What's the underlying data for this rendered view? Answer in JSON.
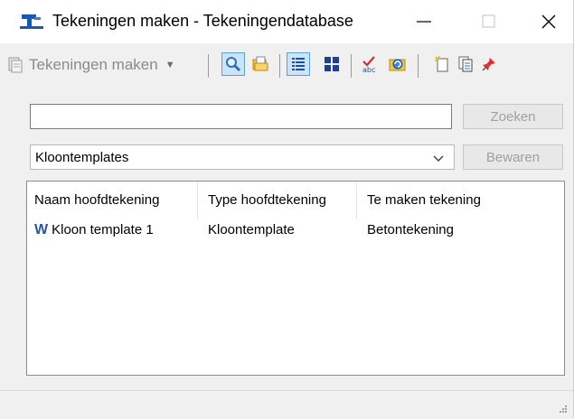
{
  "window": {
    "title": "Tekeningen maken - Tekeningendatabase",
    "minimize": "—",
    "maximize": "☐",
    "close": "✕"
  },
  "toolbar": {
    "mode_label": "Tekeningen maken",
    "buttons": [
      {
        "name": "search-icon",
        "active": true
      },
      {
        "name": "open-folder-icon",
        "active": false
      },
      {
        "name": "list-view-icon",
        "active": true
      },
      {
        "name": "grid-view-icon",
        "active": false
      },
      {
        "name": "spellcheck-icon",
        "active": false
      },
      {
        "name": "refresh-icon",
        "active": false
      },
      {
        "name": "new-document-icon",
        "active": false
      },
      {
        "name": "copy-document-icon",
        "active": false
      },
      {
        "name": "pin-icon",
        "active": false
      }
    ]
  },
  "search": {
    "value": "",
    "button_label": "Zoeken"
  },
  "filter": {
    "selected": "Kloontemplates",
    "save_label": "Bewaren"
  },
  "table": {
    "columns": [
      "Naam hoofdtekening",
      "Type hoofdtekening",
      "Te maken tekening"
    ],
    "rows": [
      {
        "icon": "W",
        "name": "Kloon template 1",
        "type": "Kloontemplate",
        "target": "Betontekening"
      }
    ]
  },
  "colors": {
    "accent": "#0078d7",
    "active_bg": "#cce4f7",
    "word_icon": "#2b5797"
  }
}
